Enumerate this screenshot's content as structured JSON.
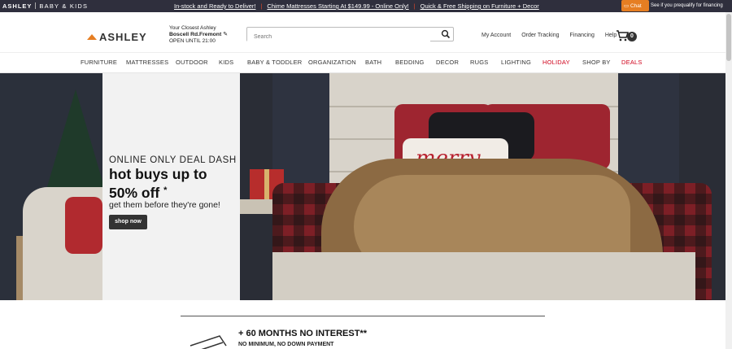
{
  "topbar": {
    "brand": "ASHLEY",
    "brand_sub": "BABY & KIDS",
    "promos": [
      "In-stock and Ready to Deliver!",
      "Chime Mattresses Starting At $149.99 - Online Only!",
      "Quick & Free Shipping on Furniture + Decor"
    ],
    "chat_label": "Chat",
    "financing_text": "See if you prequalify for financing"
  },
  "header": {
    "logo": "ASHLEY",
    "store_label": "Your Closest Ashley",
    "store_name": "Boscell Rd.Fremont",
    "store_hours": "OPEN UNTIL 21:00",
    "search_placeholder": "Search",
    "links": [
      "My Account",
      "Order Tracking",
      "Financing",
      "Help"
    ],
    "cart_count": "0"
  },
  "nav": {
    "items": [
      {
        "label": "FURNITURE",
        "highlight": false
      },
      {
        "label": "MATTRESSES",
        "highlight": false
      },
      {
        "label": "OUTDOOR",
        "highlight": false
      },
      {
        "label": "KIDS",
        "highlight": false
      },
      {
        "label": "BABY & TODDLER",
        "highlight": false
      },
      {
        "label": "ORGANIZATION",
        "highlight": false
      },
      {
        "label": "BATH",
        "highlight": false
      },
      {
        "label": "BEDDING",
        "highlight": false
      },
      {
        "label": "DECOR",
        "highlight": false
      },
      {
        "label": "RUGS",
        "highlight": false
      },
      {
        "label": "LIGHTING",
        "highlight": false
      },
      {
        "label": "HOLIDAY",
        "highlight": true
      },
      {
        "label": "SHOP BY",
        "highlight": false
      },
      {
        "label": "DEALS",
        "highlight": true
      }
    ]
  },
  "hero": {
    "kicker": "ONLINE ONLY DEAL DASH",
    "headline_line1": "hot buys up to",
    "headline_line2": "50% off",
    "asterisk": "*",
    "sub": "get them before they're gone!",
    "cta": "shop now",
    "pillow_text": "merry"
  },
  "financing_band": {
    "title": "+ 60 MONTHS NO INTEREST**",
    "subtitle": "NO MINIMUM, NO DOWN PAYMENT"
  },
  "colors": {
    "topbar_bg": "#2f2f3d",
    "accent_orange": "#e67e22",
    "deal_red": "#d0021b",
    "cta_bg": "#333333"
  }
}
